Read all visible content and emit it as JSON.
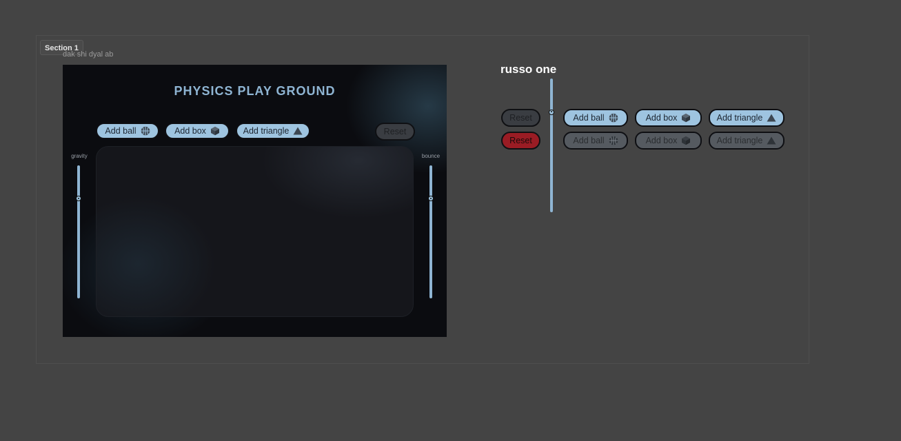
{
  "section": {
    "tag": "Section 1",
    "frame_label": "dak shi dyal ab"
  },
  "main": {
    "title": "PHYSICS PLAY GROUND",
    "add_ball": "Add ball",
    "add_box": "Add box",
    "add_triangle": "Add triangle",
    "reset": "Reset",
    "gravity_label": "gravity",
    "bounce_label": "bounce",
    "gravity_level": 0.25,
    "bounce_level": 0.25
  },
  "components": {
    "font_label": "russo one",
    "reset_default": "Reset",
    "reset_active": "Reset",
    "add_ball": "Add ball",
    "add_box": "Add box",
    "add_triangle": "Add triangle",
    "add_ball_disabled": "Add ball",
    "add_box_disabled": "Add box",
    "add_triangle_disabled": "Add triangle",
    "slider_level": 0.25
  },
  "icons": [
    "basketball-icon",
    "cube-icon",
    "triangle-icon"
  ],
  "colors": {
    "accent": "#9ec4e0",
    "title": "#8fb5d3",
    "danger": "#9a1c24",
    "background": "#444444"
  }
}
